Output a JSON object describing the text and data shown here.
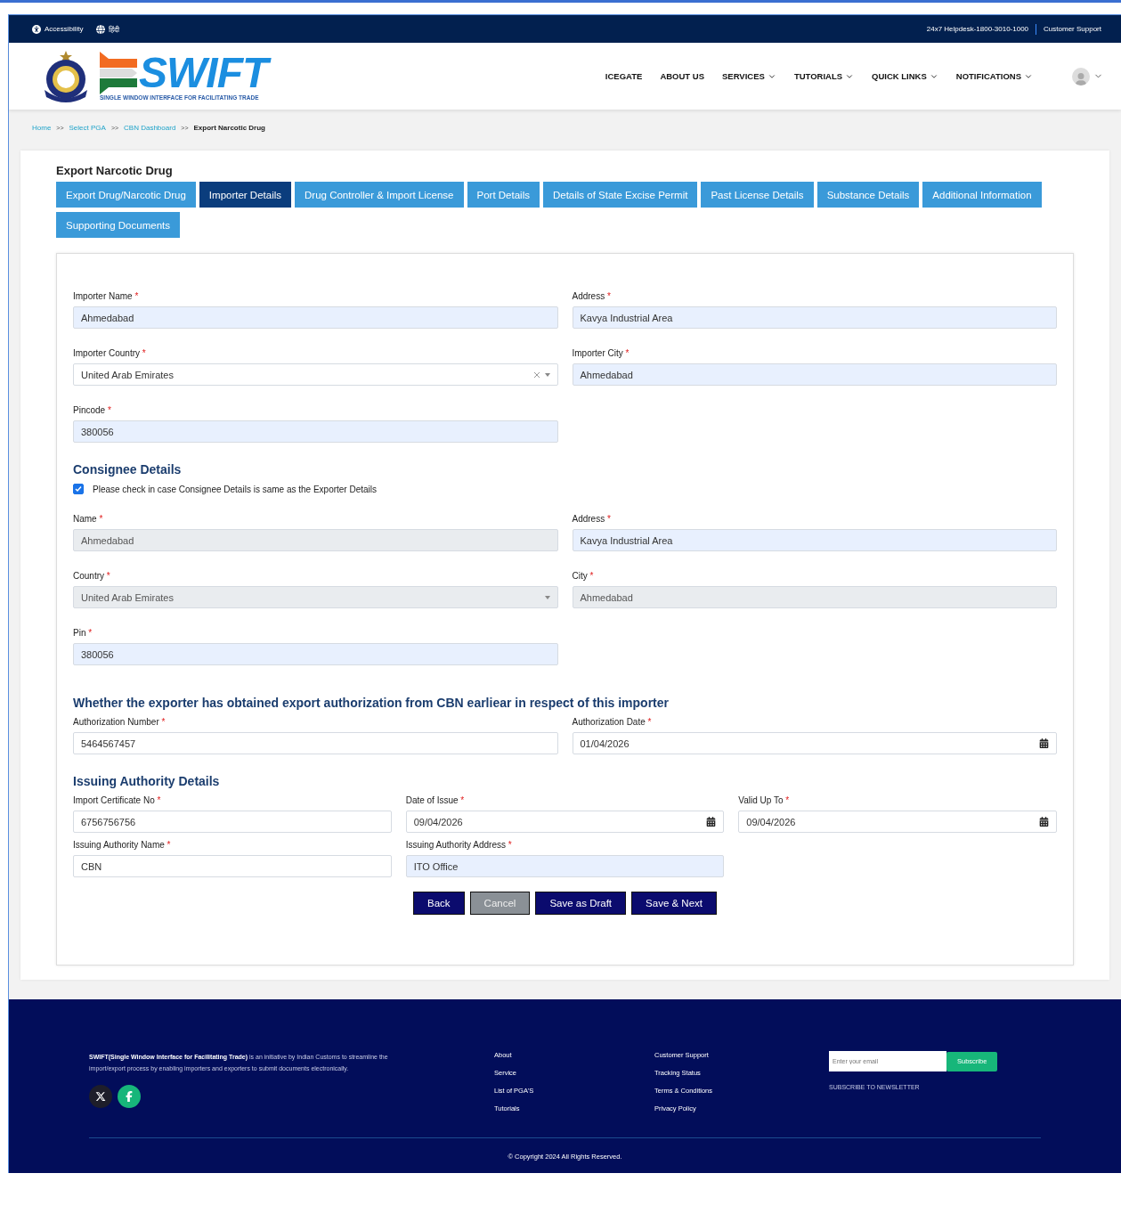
{
  "topbar": {
    "accessibility": "Accessibility",
    "language": "हिंदी",
    "helpdesk": "24x7 Helpdesk-1800-3010-1000",
    "support": "Customer Support"
  },
  "header": {
    "logo_text": "SWIFT",
    "logo_tagline": "SINGLE WINDOW INTERFACE FOR FACILITATING TRADE",
    "nav": [
      {
        "label": "ICEGATE",
        "dropdown": false
      },
      {
        "label": "ABOUT US",
        "dropdown": false
      },
      {
        "label": "SERVICES",
        "dropdown": true
      },
      {
        "label": "TUTORIALS",
        "dropdown": true
      },
      {
        "label": "QUICK LINKS",
        "dropdown": true
      },
      {
        "label": "NOTIFICATIONS",
        "dropdown": true
      }
    ]
  },
  "breadcrumb": [
    {
      "label": "Home",
      "kind": "link"
    },
    {
      "label": ">>",
      "kind": "separator"
    },
    {
      "label": "Select PGA",
      "kind": "link"
    },
    {
      "label": ">>",
      "kind": "separator"
    },
    {
      "label": "CBN Dashboard",
      "kind": "link"
    },
    {
      "label": ">>",
      "kind": "separator"
    },
    {
      "label": "Export Narcotic Drug",
      "kind": "current"
    }
  ],
  "form_title": "Export Narcotic Drug",
  "tabs": [
    {
      "label": "Export Drug/Narcotic Drug",
      "selected": false
    },
    {
      "label": "Importer Details",
      "selected": true
    },
    {
      "label": "Drug Controller & Import License",
      "selected": false
    },
    {
      "label": "Port Details",
      "selected": false
    },
    {
      "label": "Details of State Excise Permit",
      "selected": false
    },
    {
      "label": "Past License Details",
      "selected": false
    },
    {
      "label": "Substance Details",
      "selected": false
    },
    {
      "label": "Additional Information",
      "selected": false
    },
    {
      "label": "Supporting Documents",
      "selected": false
    }
  ],
  "importer_fields": [
    {
      "label": "Importer Name",
      "required": "*",
      "value": "Ahmedabad",
      "kind": "text",
      "autofilled": true,
      "disabled": false
    },
    {
      "label": "Address",
      "required": "*",
      "value": "Kavya Industrial Area",
      "kind": "text",
      "autofilled": true,
      "disabled": false
    },
    {
      "label": "Importer Country",
      "required": "*",
      "value": "United Arab Emirates",
      "kind": "select",
      "autofilled": false,
      "disabled": false,
      "clearable": true
    },
    {
      "label": "Importer City",
      "required": "*",
      "value": "Ahmedabad",
      "kind": "text",
      "autofilled": true,
      "disabled": false
    },
    {
      "label": "Pincode",
      "required": "*",
      "value": "380056",
      "kind": "text",
      "autofilled": true,
      "disabled": false
    }
  ],
  "consignee": {
    "title": "Consignee Details",
    "same_as_exporter": {
      "label": "Please check in case Consignee Details is same as the Exporter Details",
      "checked": true
    },
    "fields": [
      {
        "label": "Name",
        "required": "*",
        "value": "Ahmedabad",
        "kind": "text",
        "autofilled": false,
        "disabled": true
      },
      {
        "label": "Address",
        "required": "*",
        "value": "Kavya Industrial Area",
        "kind": "text",
        "autofilled": true,
        "disabled": false
      },
      {
        "label": "Country",
        "required": "*",
        "value": "United Arab Emirates",
        "kind": "select",
        "autofilled": false,
        "disabled": true,
        "clearable": false
      },
      {
        "label": "City",
        "required": "*",
        "value": "Ahmedabad",
        "kind": "text",
        "autofilled": false,
        "disabled": true
      },
      {
        "label": "Pin",
        "required": "*",
        "value": "380056",
        "kind": "text",
        "autofilled": true,
        "disabled": false
      }
    ]
  },
  "authorization": {
    "title": "Whether the exporter has obtained export authorization from CBN earliear in respect of this importer",
    "fields": [
      {
        "label": "Authorization Number",
        "required": "*",
        "value": "5464567457",
        "kind": "text",
        "autofilled": false,
        "disabled": false
      },
      {
        "label": "Authorization Date",
        "required": "*",
        "value": "01/04/2026",
        "kind": "date",
        "autofilled": false,
        "disabled": false
      }
    ]
  },
  "issuing": {
    "title": "Issuing Authority Details",
    "fields": [
      {
        "label": "Import Certificate No",
        "required": "*",
        "value": "6756756756",
        "kind": "text",
        "autofilled": false,
        "disabled": false
      },
      {
        "label": "Date of Issue",
        "required": "*",
        "value": "09/04/2026",
        "kind": "date",
        "autofilled": false,
        "disabled": false
      },
      {
        "label": "Valid Up To",
        "required": "*",
        "value": "09/04/2026",
        "kind": "date",
        "autofilled": false,
        "disabled": false
      },
      {
        "label": "Issuing Authority Name",
        "required": "*",
        "value": "CBN",
        "kind": "text",
        "autofilled": false,
        "disabled": false
      },
      {
        "label": "Issuing Authority Address",
        "required": "*",
        "value": "ITO Office",
        "kind": "text",
        "autofilled": true,
        "disabled": false
      }
    ]
  },
  "buttons": [
    {
      "label": "Back",
      "disabled": false
    },
    {
      "label": "Cancel",
      "disabled": true
    },
    {
      "label": "Save as Draft",
      "disabled": false
    },
    {
      "label": "Save & Next",
      "disabled": false
    }
  ],
  "footer": {
    "description": "**SWIFT(Single Window Interface for Facilitating Trade)** is an initiative by Indian Customs to streamline the import/export process by enabling importers and exporters to submit documents electronically.",
    "links_1": [
      "About",
      "Service",
      "List of PGA'S",
      "Tutorials"
    ],
    "links_2": [
      "Customer Support",
      "Tracking Status",
      "Terms & Conditions",
      "Privacy Policy"
    ],
    "email_placeholder": "Enter your email",
    "subscribe": "Subscribe",
    "newsletter": "SUBSCRIBE TO NEWSLETTER",
    "copyright": "© Copyright 2024 All Rights Reserved."
  }
}
